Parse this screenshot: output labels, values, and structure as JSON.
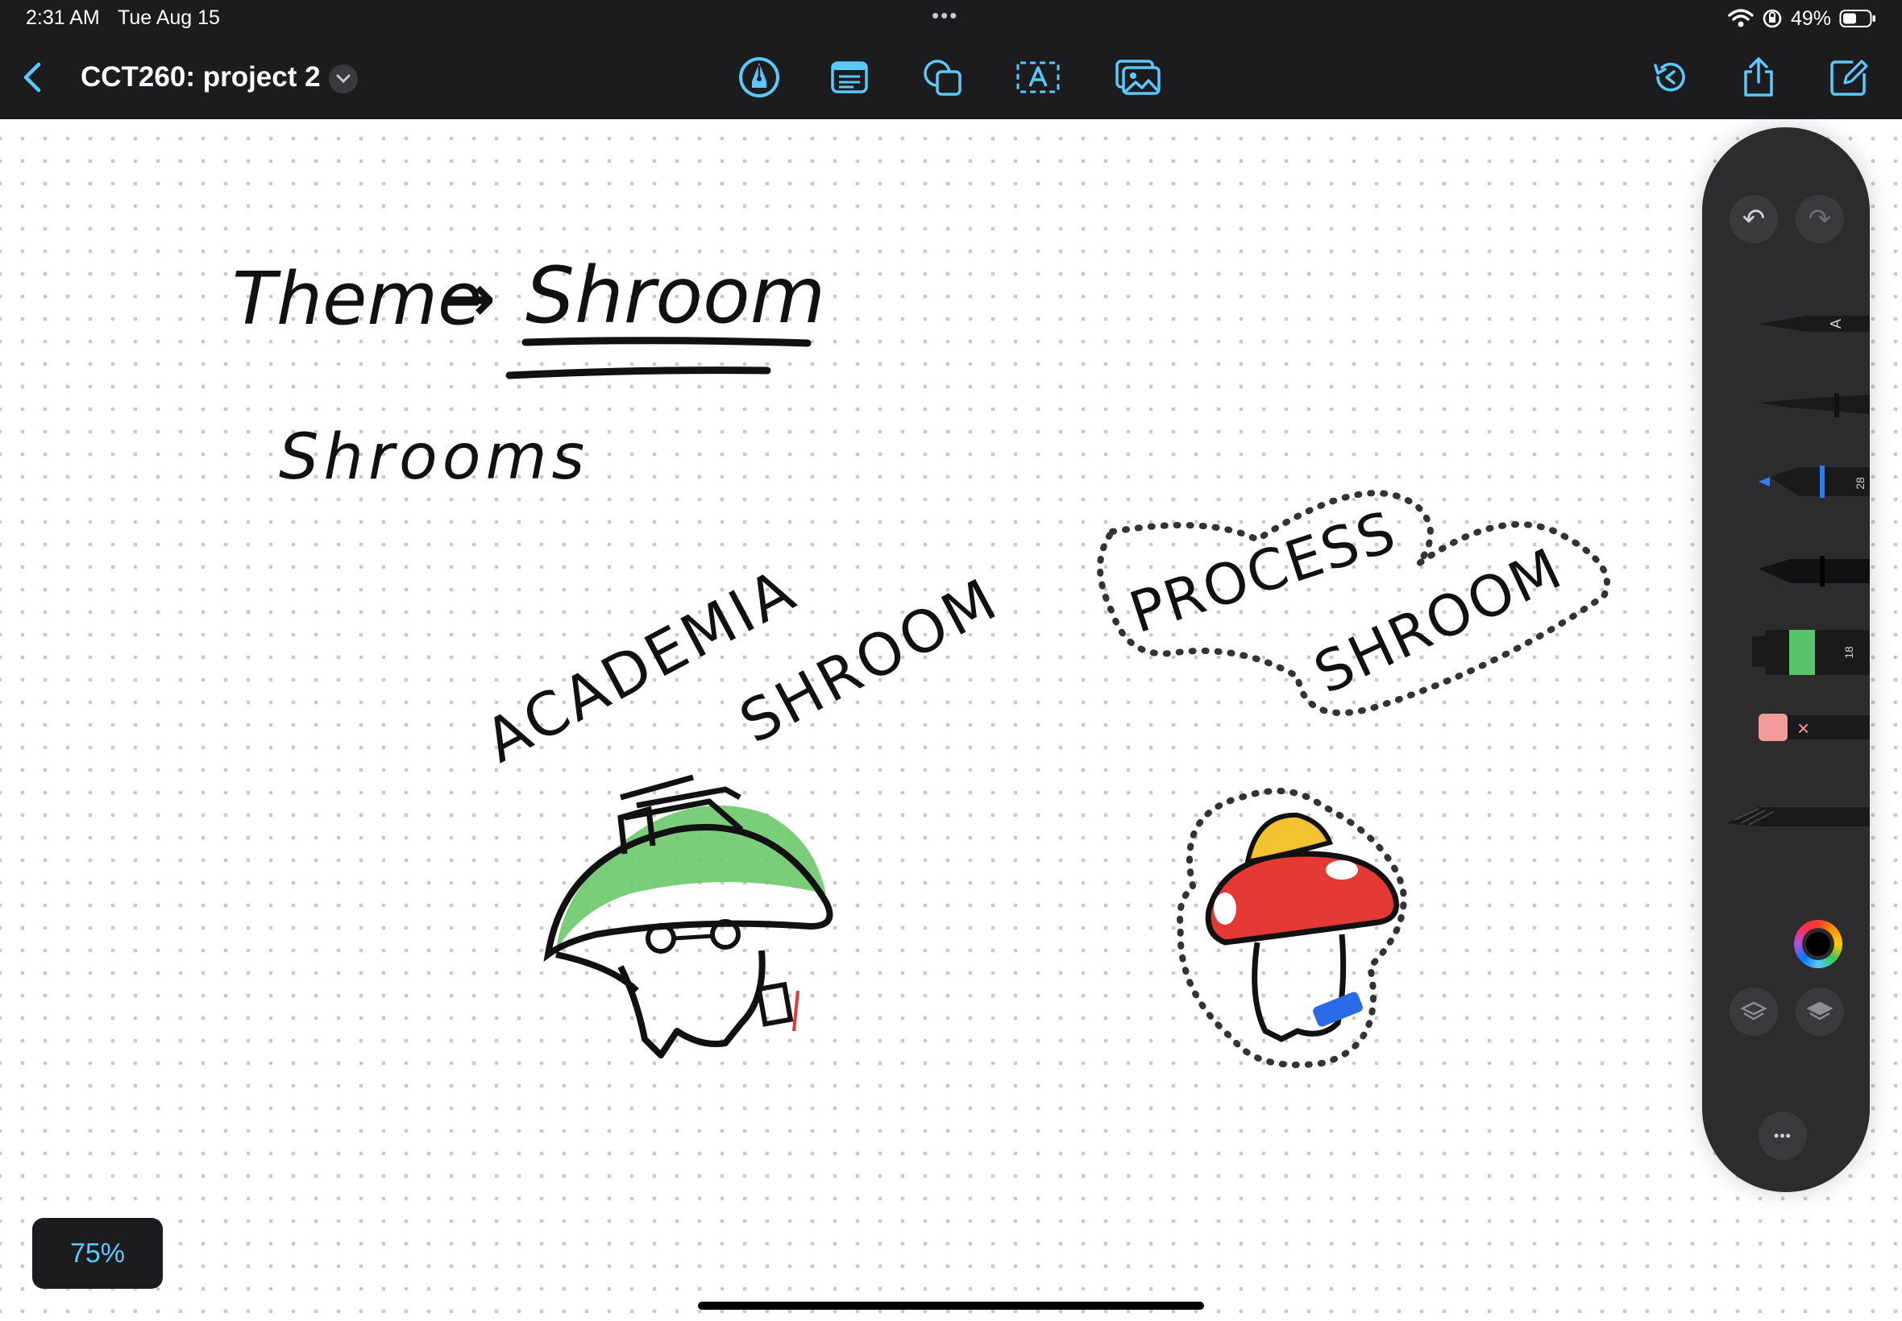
{
  "status_bar": {
    "time": "2:31 AM",
    "date": "Tue Aug 15",
    "battery": "49%",
    "icons": [
      "wifi-icon",
      "orientation-lock-icon",
      "battery-icon"
    ]
  },
  "toolbar": {
    "title": "CCT260: project 2",
    "tools": [
      "pen-tool-icon",
      "text-box-icon",
      "shapes-icon",
      "text-icon",
      "media-icon"
    ],
    "right_actions": [
      "history-icon",
      "share-icon",
      "compose-icon"
    ],
    "accent_color": "#5ac8fa"
  },
  "canvas": {
    "texts": {
      "theme": "Theme",
      "arrow": "→",
      "shroom": "Shroom",
      "shrooms": "Shrooms",
      "academia": "ACADEMIA",
      "academia_shroom": "SHROOM",
      "process": "PROCESS",
      "process_shroom": "SHROOM"
    },
    "colors": {
      "ink": "#111111",
      "cap_green": "#6cc96a",
      "cap_red": "#e53935",
      "cap_yellow": "#f2c230",
      "marker_blue": "#2a6ae8"
    }
  },
  "palette": {
    "tools": [
      {
        "name": "pen",
        "label": "A"
      },
      {
        "name": "fineliner",
        "label": ""
      },
      {
        "name": "fountain-pen",
        "label": "28",
        "color": "#2f7bf6"
      },
      {
        "name": "marker",
        "label": ""
      },
      {
        "name": "highlighter",
        "label": "18",
        "color": "#55c46b"
      },
      {
        "name": "eraser",
        "label": "×"
      },
      {
        "name": "crayon",
        "label": ""
      }
    ],
    "undo_label": "↶",
    "redo_label": "↷",
    "more_label": "•••"
  },
  "zoom": {
    "label": "75%"
  }
}
